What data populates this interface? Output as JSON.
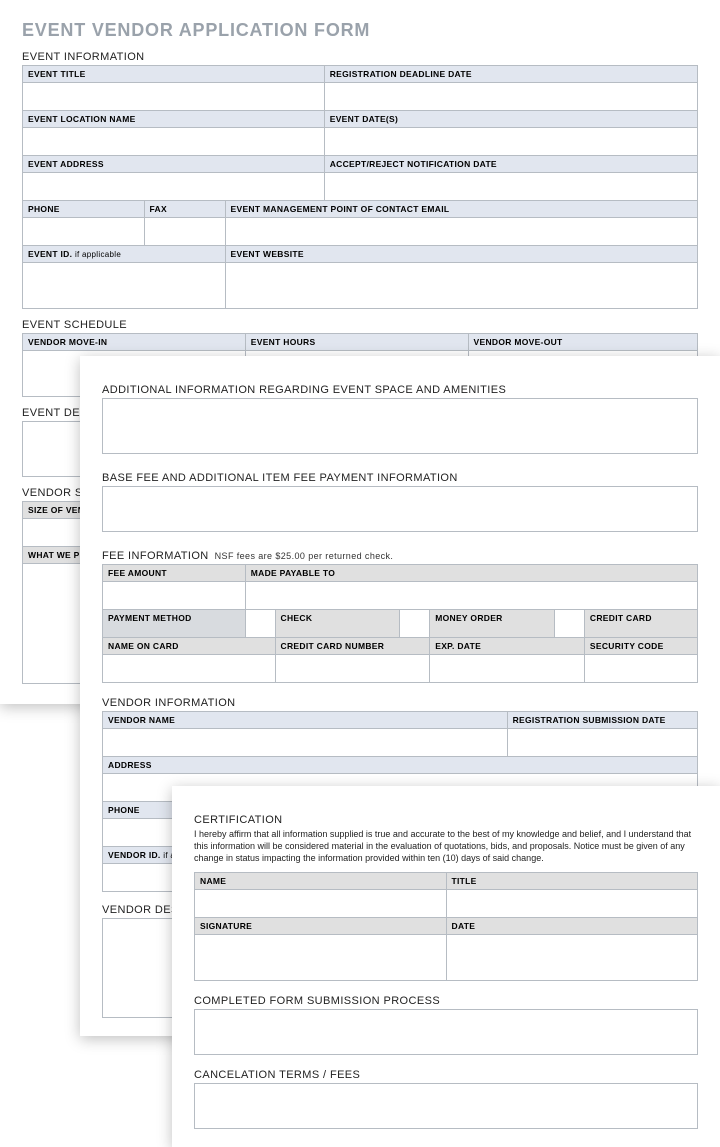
{
  "title": "EVENT VENDOR APPLICATION FORM",
  "p1": {
    "h_event_info": "EVENT INFORMATION",
    "event_title": "EVENT TITLE",
    "reg_deadline": "REGISTRATION DEADLINE DATE",
    "event_location": "EVENT LOCATION NAME",
    "event_dates": "EVENT DATE(S)",
    "event_address": "EVENT ADDRESS",
    "accept_reject": "ACCEPT/REJECT NOTIFICATION DATE",
    "phone": "PHONE",
    "fax": "FAX",
    "mgmt_email": "EVENT MANAGEMENT POINT OF CONTACT EMAIL",
    "event_id": "EVENT ID.",
    "event_id_note": "if applicable",
    "event_website": "EVENT WEBSITE",
    "h_schedule": "EVENT SCHEDULE",
    "move_in": "VENDOR MOVE-IN",
    "hours": "EVENT HOURS",
    "move_out": "VENDOR MOVE-OUT",
    "h_desc": "EVENT DESCRIPTION",
    "h_vsp": "VENDOR SPACE",
    "size": "SIZE OF VENDOR SPACE",
    "provide": "WHAT WE PROVIDE"
  },
  "p2": {
    "h_additional": "ADDITIONAL INFORMATION REGARDING EVENT SPACE AND AMENITIES",
    "h_basefee": "BASE FEE AND ADDITIONAL ITEM FEE PAYMENT INFORMATION",
    "h_feeinfo": "FEE INFORMATION",
    "fee_note": "NSF fees are $25.00 per returned check.",
    "fee_amount": "FEE AMOUNT",
    "payable": "MADE PAYABLE TO",
    "method": "PAYMENT METHOD",
    "check": "CHECK",
    "money_order": "MONEY ORDER",
    "credit_card": "CREDIT CARD",
    "name_on_card": "NAME ON CARD",
    "cc_number": "CREDIT CARD NUMBER",
    "exp": "EXP. DATE",
    "cvv": "SECURITY CODE",
    "h_vendor": "VENDOR INFORMATION",
    "vname": "VENDOR NAME",
    "reg_sub": "REGISTRATION SUBMISSION DATE",
    "address": "ADDRESS",
    "phone": "PHONE",
    "vendor_id": "VENDOR ID.",
    "vendor_id_note": "if applicable",
    "h_vdesc": "VENDOR DESCRIPTION"
  },
  "p3": {
    "h_cert": "CERTIFICATION",
    "cert_text": "I hereby affirm that all information supplied is true and accurate to the best of my knowledge and belief, and I understand that this information will be considered material in the evaluation of quotations, bids, and proposals. Notice must be given of any change in status impacting the information provided within ten (10) days of said change.",
    "name": "NAME",
    "title": "TITLE",
    "sig": "SIGNATURE",
    "date": "DATE",
    "h_submit": "COMPLETED FORM SUBMISSION PROCESS",
    "h_cancel": "CANCELATION TERMS / FEES"
  }
}
